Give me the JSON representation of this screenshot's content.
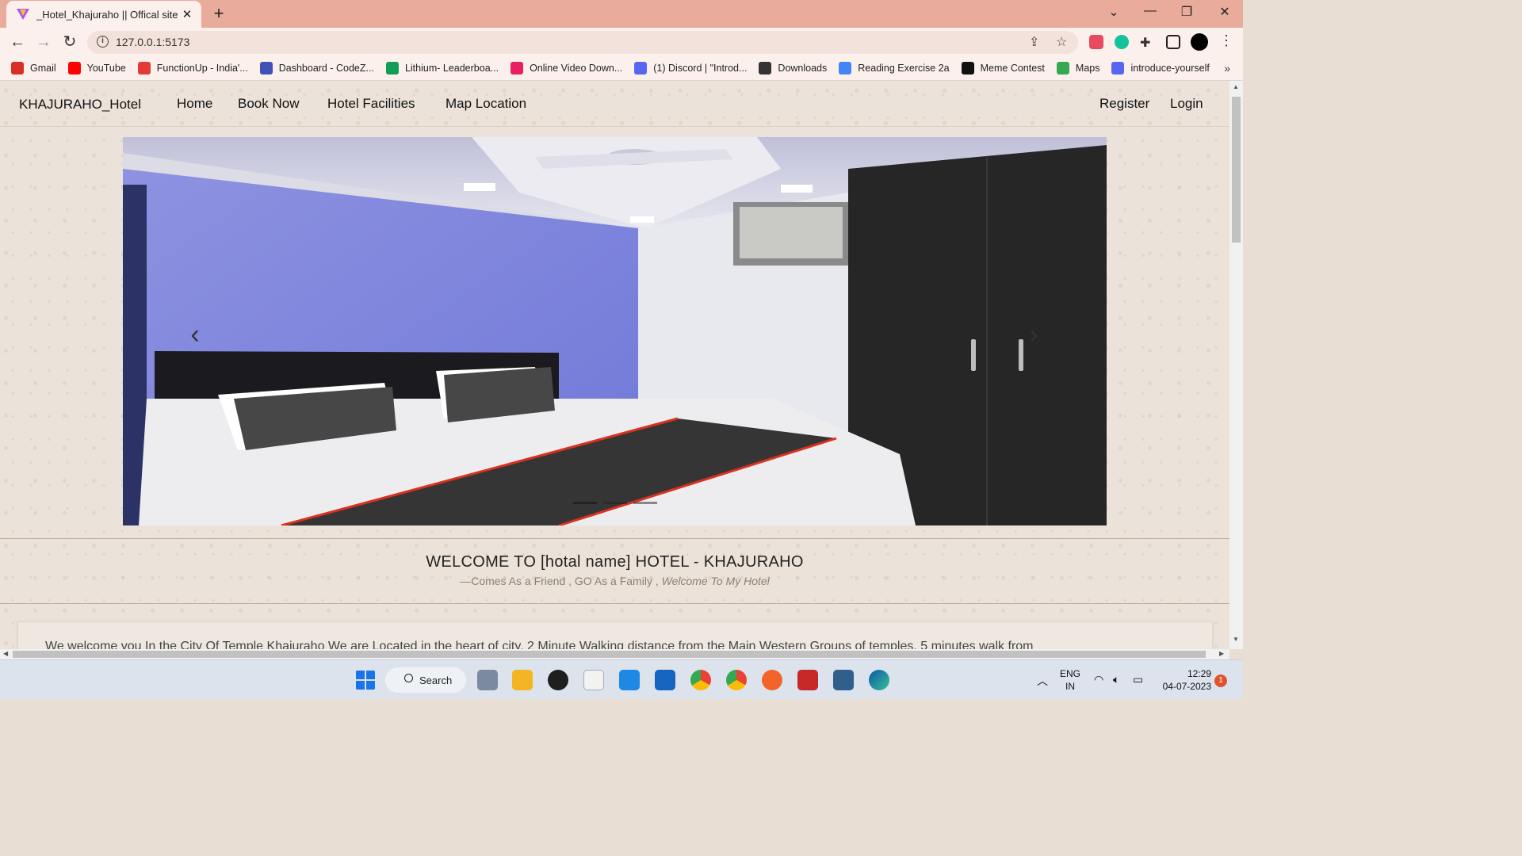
{
  "browser": {
    "tab_title": "_Hotel_Khajuraho || Offical site",
    "tab_close": "✕",
    "new_tab": "+",
    "url": "127.0.0.1:5173",
    "window_controls": {
      "dropdown": "⌄",
      "minimize": "—",
      "restore": "❐",
      "close": "✕"
    },
    "nav": {
      "back": "←",
      "forward": "→",
      "reload": "↻"
    },
    "bookmarks": [
      {
        "label": "Gmail",
        "icon": "gmail-icon",
        "color": "#d93025"
      },
      {
        "label": "YouTube",
        "icon": "youtube-icon",
        "color": "#ff0000"
      },
      {
        "label": "FunctionUp - India'...",
        "icon": "functionup-icon",
        "color": "#e53935"
      },
      {
        "label": "Dashboard - CodeZ...",
        "icon": "codez-icon",
        "color": "#3f51b5"
      },
      {
        "label": "Lithium- Leaderboa...",
        "icon": "sheets-icon",
        "color": "#0f9d58"
      },
      {
        "label": "Online Video Down...",
        "icon": "video-download-icon",
        "color": "#e91e63"
      },
      {
        "label": "(1) Discord | \"Introd...",
        "icon": "discord-icon",
        "color": "#5865f2"
      },
      {
        "label": "Downloads",
        "icon": "download-icon",
        "color": "#333333"
      },
      {
        "label": "Reading Exercise 2a",
        "icon": "docs-icon",
        "color": "#4285f4"
      },
      {
        "label": "Meme Contest",
        "icon": "notion-icon",
        "color": "#111111"
      },
      {
        "label": "Maps",
        "icon": "maps-icon",
        "color": "#34a853"
      },
      {
        "label": "introduce-yourself",
        "icon": "discord-icon",
        "color": "#5865f2"
      }
    ],
    "bookmarks_more": "»"
  },
  "site": {
    "brand": "KHAJURAHO_Hotel",
    "nav": [
      "Home",
      "Book Now",
      "Hotel Facilities",
      "Map Location"
    ],
    "auth": {
      "register": "Register",
      "login": "Login"
    },
    "carousel": {
      "prev": "‹",
      "next": "›",
      "slides": 3,
      "active": 0
    },
    "welcome_title": "WELCOME TO [hotal name] HOTEL - KHAJURAHO",
    "welcome_sub_plain": "—Comes As a Friend , GO As a Family ,",
    "welcome_sub_italic": "Welcome To My Hotel",
    "intro_text": "We welcome you In the City Of Temple Khajuraho We are Located in the heart of city, 2 Minute Walking distance from the Main Western Groups of temples, 5 minutes walk from"
  },
  "taskbar": {
    "search_label": "Search",
    "lang_top": "ENG",
    "lang_bottom": "IN",
    "time": "12:29",
    "date": "04-07-2023",
    "notifications": "1",
    "apps": [
      {
        "name": "file-explorer-icon",
        "color": "#f3b521"
      },
      {
        "name": "chrome-icon",
        "color": "#4285f4"
      },
      {
        "name": "vscode-icon",
        "color": "#1e88e5"
      }
    ]
  },
  "colors": {
    "tabstrip": "#e8ab9c",
    "toolbar": "#fbf0ec",
    "page_bg": "#ebe3d9",
    "taskbar": "#dde3ed"
  }
}
